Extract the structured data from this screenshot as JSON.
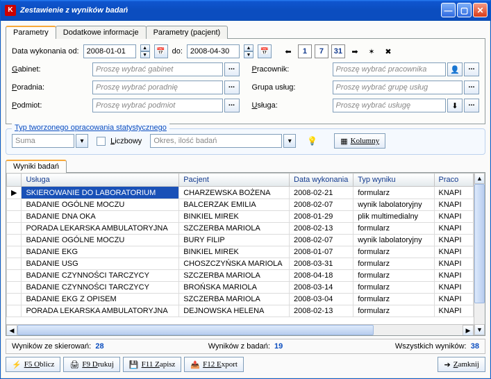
{
  "window": {
    "title": "Zestawienie z wyników badań"
  },
  "tabs": [
    "Parametry",
    "Dodatkowe informacje",
    "Parametry (pacjent)"
  ],
  "dates": {
    "from_label": "Data wykonania od:",
    "to_label": "do:",
    "from": "2008-01-01",
    "to": "2008-04-30"
  },
  "filters_left": [
    {
      "key": "gabinet",
      "label": "Gabinet:",
      "letter": "G",
      "placeholder": "Proszę wybrać gabinet"
    },
    {
      "key": "poradnia",
      "label": "Poradnia:",
      "letter": "P",
      "placeholder": "Proszę wybrać poradnię"
    },
    {
      "key": "podmiot",
      "label": "Podmiot:",
      "letter": "P",
      "placeholder": "Proszę wybrać podmiot"
    }
  ],
  "filters_right": [
    {
      "key": "pracownik",
      "label": "Pracownik:",
      "letter": "P",
      "placeholder": "Proszę wybrać pracownika",
      "extra": true
    },
    {
      "key": "grupa",
      "label": "Grupa usług:",
      "letter": "",
      "placeholder": "Proszę wybrać grupę usług"
    },
    {
      "key": "usluga",
      "label": "Usługa:",
      "letter": "U",
      "placeholder": "Proszę wybrać usługę",
      "extra": true
    }
  ],
  "group": {
    "title": "Typ tworzonego opracowania statystycznego",
    "suma": "Suma",
    "liczbowy_label": "Liczbowy",
    "liczbowy_value": "Okres, ilość badań",
    "kolumny": "Kolumny"
  },
  "grid": {
    "tab": "Wyniki badań",
    "columns": [
      "",
      "Usługa",
      "Pacjent",
      "Data wykonania",
      "Typ wyniku",
      "Praco"
    ],
    "rows": [
      [
        "SKIEROWANIE DO LABORATORIUM",
        "CHARZEWSKA BOŻENA",
        "2008-02-21",
        "formularz",
        "KNAPI"
      ],
      [
        "BADANIE OGÓLNE MOCZU",
        "BALCERZAK EMILIA",
        "2008-02-07",
        "wynik labolatoryjny",
        "KNAPI"
      ],
      [
        "BADANIE DNA OKA",
        "BINKIEL MIREK",
        "2008-01-29",
        "plik multimedialny",
        "KNAPI"
      ],
      [
        "PORADA LEKARSKA AMBULATORYJNA",
        "SZCZERBA MARIOLA",
        "2008-02-13",
        "formularz",
        "KNAPI"
      ],
      [
        "BADANIE OGÓLNE MOCZU",
        "BURY FILIP",
        "2008-02-07",
        "wynik labolatoryjny",
        "KNAPI"
      ],
      [
        "BADANIE EKG",
        "BINKIEL MIREK",
        "2008-01-07",
        "formularz",
        "KNAPI"
      ],
      [
        "BADANIE USG",
        "CHOSZCZYŃSKA MARIOLA",
        "2008-03-31",
        "formularz",
        "KNAPI"
      ],
      [
        "BADANIE CZYNNOŚCI TARCZYCY",
        "SZCZERBA MARIOLA",
        "2008-04-18",
        "formularz",
        "KNAPI"
      ],
      [
        "BADANIE CZYNNOŚCI TARCZYCY",
        "BROŃSKA MARIOLA",
        "2008-03-14",
        "formularz",
        "KNAPI"
      ],
      [
        "BADANIE EKG Z OPISEM",
        "SZCZERBA MARIOLA",
        "2008-03-04",
        "formularz",
        "KNAPI"
      ],
      [
        "PORADA LEKARSKA AMBULATORYJNA",
        "DEJNOWSKA HELENA",
        "2008-02-13",
        "formularz",
        "KNAPI"
      ]
    ]
  },
  "status": {
    "skierowan_label": "Wyników ze skierowań:",
    "skierowan": "28",
    "badan_label": "Wyników z badań:",
    "badan": "19",
    "wszystkich_label": "Wszystkich wyników:",
    "wszystkich": "38"
  },
  "buttons": {
    "oblicz": "F5 Oblicz",
    "drukuj": "F9 Drukuj",
    "zapisz": "F11 Zapisz",
    "export": "F12 Export",
    "zamknij": "Zamknij"
  }
}
